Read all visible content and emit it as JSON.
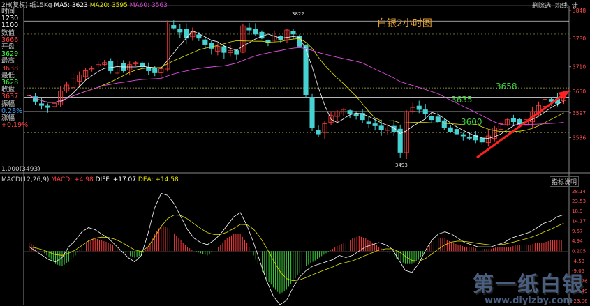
{
  "header": {
    "title": "2H(复权)",
    "period": "纸15Kg",
    "ma5_label": "MA5: 3623",
    "ma20_label": "MA20: 3595",
    "ma60_label": "MA60: 3563",
    "right_buttons": [
      "删除选",
      "均线",
      "计"
    ],
    "colors": {
      "ma5": "#ffffff",
      "ma20": "#e6e600",
      "ma60": "#e04ce0"
    }
  },
  "left_panel": {
    "items": [
      {
        "label": "时间",
        "color": "#cccccc"
      },
      {
        "label": "1230",
        "color": "#ffffff"
      },
      {
        "label": "1100",
        "color": "#ffffff"
      },
      {
        "label": "数值",
        "color": "#cccccc"
      },
      {
        "label": "3666",
        "color": "#ff4040"
      },
      {
        "label": "开盘",
        "color": "#cccccc"
      },
      {
        "label": "3629",
        "color": "#40ff40"
      },
      {
        "label": "最高",
        "color": "#cccccc"
      },
      {
        "label": "3638",
        "color": "#ff4040"
      },
      {
        "label": "最低",
        "color": "#cccccc"
      },
      {
        "label": "3628",
        "color": "#40ff40"
      },
      {
        "label": "收盘",
        "color": "#cccccc"
      },
      {
        "label": "3637",
        "color": "#ff4040"
      },
      {
        "label": "振幅",
        "color": "#cccccc"
      },
      {
        "label": "0.28%",
        "color": "#40a0ff"
      },
      {
        "label": "涨幅",
        "color": "#cccccc"
      },
      {
        "label": "+0.19%",
        "color": "#ff4040"
      }
    ]
  },
  "scale_label": "1.000(3493)",
  "annotations": {
    "title": "白银2小时图",
    "level_3658": "3658",
    "level_3635": "3635",
    "level_3600": "3600",
    "high_label": "3822",
    "low_label": "3493"
  },
  "macd_header": {
    "name": "MACD(12,26,9)",
    "macd": "MACD: +4.98",
    "diff": "DIFF: +17.07",
    "dea": "DEA: +14.58",
    "button": "指标说明"
  },
  "watermark": {
    "main": "第一纸白银",
    "url": "www.diyizby.com"
  },
  "chart_data": [
    {
      "type": "candlestick",
      "title": "白银2小时图",
      "ylim": [
        3470,
        3860
      ],
      "y_ticks": [
        3848,
        3780,
        3710,
        3650,
        3597,
        3536
      ],
      "horizontal_levels": [
        3822,
        3712,
        3658,
        3635,
        3600,
        3493
      ],
      "series": [
        {
          "name": "MA5",
          "value": 3623
        },
        {
          "name": "MA20",
          "value": 3595
        },
        {
          "name": "MA60",
          "value": 3563
        }
      ],
      "close_path": [
        3640,
        3625,
        3615,
        3610,
        3620,
        3650,
        3665,
        3680,
        3690,
        3700,
        3705,
        3715,
        3720,
        3700,
        3712,
        3700,
        3715,
        3720,
        3710,
        3700,
        3695,
        3705,
        3815,
        3805,
        3795,
        3780,
        3795,
        3780,
        3765,
        3755,
        3760,
        3745,
        3750,
        3740,
        3810,
        3800,
        3790,
        3780,
        3770,
        3785,
        3775,
        3800,
        3790,
        3760,
        3640,
        3560,
        3545,
        3570,
        3590,
        3600,
        3605,
        3595,
        3590,
        3580,
        3570,
        3565,
        3555,
        3560,
        3550,
        3500,
        3600,
        3610,
        3605,
        3595,
        3580,
        3575,
        3560,
        3550,
        3545,
        3540,
        3536,
        3530,
        3525,
        3540,
        3560,
        3570,
        3580,
        3575,
        3570,
        3580,
        3600,
        3615,
        3630,
        3625,
        3620,
        3637
      ]
    },
    {
      "type": "macd",
      "ylim": [
        -25,
        32
      ],
      "y_ticks": [
        28.14,
        23.53,
        18.9,
        14.17,
        9.57,
        4.94,
        0.205,
        -4.53,
        -9.05,
        -13.76,
        -18.49,
        -23.06
      ],
      "diff_latest": 17.07,
      "dea_latest": 14.58,
      "macd_latest": 4.98,
      "diff_path": [
        2,
        0,
        -2,
        -4,
        -5,
        -3,
        2,
        5,
        9,
        11,
        10,
        8,
        6,
        3,
        0,
        -3,
        -5,
        -2,
        8,
        20,
        27,
        26,
        22,
        16,
        10,
        6,
        4,
        3,
        5,
        8,
        12,
        16,
        18,
        12,
        4,
        -5,
        -14,
        -21,
        -25,
        -23,
        -17,
        -12,
        -9,
        -7,
        -6,
        -5,
        -4,
        -2,
        -3,
        -2,
        0,
        2,
        3,
        4,
        3,
        1,
        -4,
        -9,
        -10,
        -6,
        0,
        5,
        8,
        9,
        8,
        6,
        4,
        3,
        2,
        2,
        2,
        3,
        4,
        6,
        7,
        8,
        9,
        11,
        13,
        14,
        16,
        17
      ],
      "macd_path": [
        4,
        2,
        0,
        -3,
        -6,
        -7,
        -5,
        -2,
        2,
        5,
        6,
        5,
        4,
        2,
        0,
        -2,
        -3,
        -2,
        2,
        8,
        12,
        11,
        8,
        5,
        2,
        0,
        -1,
        -2,
        0,
        3,
        6,
        8,
        8,
        4,
        -2,
        -8,
        -13,
        -17,
        -20,
        -18,
        -14,
        -10,
        -7,
        -5,
        -3,
        -1,
        1,
        3,
        4,
        6,
        7,
        6,
        4,
        2,
        0,
        -2,
        -4,
        -6,
        -6,
        -4,
        0,
        4,
        6,
        6,
        4,
        3,
        2,
        2,
        1,
        1,
        1,
        2,
        2,
        2,
        3,
        3,
        3,
        4,
        4,
        5,
        5,
        5
      ]
    }
  ]
}
